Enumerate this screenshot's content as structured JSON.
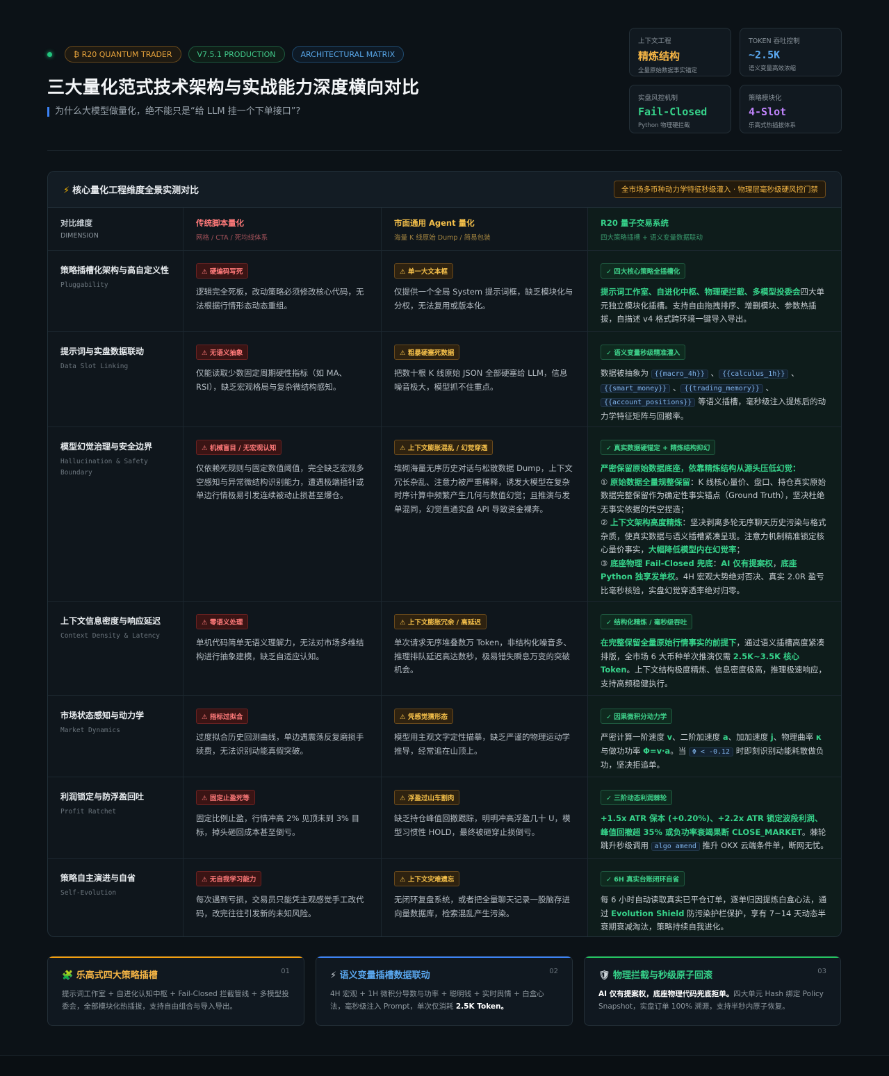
{
  "header": {
    "badges": [
      "₿ R20 QUANTUM TRADER",
      "V7.5.1 PRODUCTION",
      "ARCHITECTURAL MATRIX"
    ],
    "title": "三大量化范式技术架构与实战能力深度横向对比",
    "subtitle": "为什么大模型做量化，绝不能只是“给 LLM 挂一个下单接口”?"
  },
  "stats": [
    {
      "label": "上下文工程",
      "value": "精炼结构",
      "sub": "全量原始数据事实锚定",
      "color": "#f5b545"
    },
    {
      "label": "TOKEN 吞吐控制",
      "value": "~2.5K",
      "sub": "语义变量高效浓缩",
      "color": "#5aa8f0"
    },
    {
      "label": "实盘风控机制",
      "value": "Fail-Closed",
      "sub": "Python 物理硬拦截",
      "color": "#36d28a"
    },
    {
      "label": "策略模块化",
      "value": "4-Slot",
      "sub": "乐高式热插拔体系",
      "color": "#c084fc"
    }
  ],
  "panel": {
    "title": "核心量化工程维度全景实测对比",
    "tag": "全市场多币种动力学特征秒级灌入 · 物理层毫秒级硬风控门禁"
  },
  "columns": [
    {
      "a": "对比维度",
      "b": "DIMENSION",
      "ca": "#c5ccd2",
      "cb": "#8a949c"
    },
    {
      "a": "传统脚本量化",
      "b": "网格 / CTA / 死均线体系",
      "ca": "#ff7a7a",
      "cb": "#a4525a"
    },
    {
      "a": "市面通用 Agent 量化",
      "b": "海量 K 线原始 Dump / 简易包装",
      "ca": "#f5c04a",
      "cb": "#a38440"
    },
    {
      "a": "R20 量子交易系统",
      "b": "四大策略插槽 + 语义变量数据联动",
      "ca": "#36d28a",
      "cb": "#3a9a6e"
    }
  ],
  "rows": [
    {
      "dim": "策略插槽化架构与高自定义性",
      "dim_en": "Pluggability",
      "t1": "硬编码写死",
      "d1": "逻辑完全死板，改动策略必须修改核心代码，无法根据行情形态动态重组。",
      "t2": "单一大文本框",
      "d2": "仅提供一个全局 System 提示词框，缺乏模块化与分权，无法复用或版本化。",
      "t3": "四大核心策略全插槽化",
      "d3": [
        {
          "t": "提示词工作室、自进化中枢、物理硬拦截、多模型投委会",
          "c": "g"
        },
        {
          "t": "四大单元独立模块化插槽。支持自由拖拽排序、增删模块、参数热插拔，自描述 v4 格式跨环境一键导入导出。",
          "c": ""
        }
      ]
    },
    {
      "dim": "提示词与实盘数据联动",
      "dim_en": "Data Slot Linking",
      "t1": "无语义抽象",
      "d1": "仅能读取少数固定周期硬性指标（如 MA、RSI），缺乏宏观格局与复杂微结构感知。",
      "t2": "粗暴硬塞死数据",
      "d2": "把数十根 K 线原始 JSON 全部硬塞给 LLM，信息噪音极大，模型抓不住重点。",
      "t3": "语义变量秒级精准灌入",
      "d3": [
        {
          "t": "数据被抽象为 ",
          "c": ""
        },
        {
          "t": "{{macro_4h}}",
          "c": "code"
        },
        {
          "t": " 、",
          "c": ""
        },
        {
          "t": "{{calculus_1h}}",
          "c": "code"
        },
        {
          "t": " 、",
          "c": ""
        },
        {
          "t": "{{smart_money}}",
          "c": "code"
        },
        {
          "t": " 、",
          "c": ""
        },
        {
          "t": "{{trading_memory}}",
          "c": "code"
        },
        {
          "t": " 、",
          "c": ""
        },
        {
          "t": "{{account_positions}}",
          "c": "code"
        },
        {
          "t": " 等语义插槽，毫秒级注入提炼后的动力学特征矩阵与回撤率。",
          "c": ""
        }
      ]
    },
    {
      "dim": "模型幻觉治理与安全边界",
      "dim_en": "Hallucination & Safety Boundary",
      "t1": "机械盲目 / 无宏观认知",
      "d1": "仅依赖死规则与固定数值阈值，完全缺乏宏观多空感知与异常微结构识别能力，遭遇极端插针或单边行情极易引发连续被动止损甚至爆仓。",
      "t2": "上下文膨胀混乱 / 幻觉穿透",
      "d2": "堆砌海量无序历史对话与松散数据 Dump，上下文冗长杂乱、注意力被严重稀释，诱发大模型在复杂时序计算中频繁产生几何与数值幻觉；且推演与发单混同，幻觉直通实盘 API 导致资金裸奔。",
      "t3": "真实数据硬锚定 + 精炼结构抑幻",
      "d3": [
        {
          "t": "严密保留原始数据底座，依靠精炼结构从源头压低幻觉：",
          "c": "g"
        },
        {
          "t": "\n① ",
          "c": ""
        },
        {
          "t": "原始数据全量规整保留",
          "c": "g"
        },
        {
          "t": "：K 线核心量价、盘口、持仓真实原始数据完整保留作为确定性事实锚点（Ground Truth），坚决杜绝无事实依据的凭空捏造；",
          "c": ""
        },
        {
          "t": "\n② ",
          "c": ""
        },
        {
          "t": "上下文架构高度精炼",
          "c": "g"
        },
        {
          "t": "：坚决剥离多轮无序聊天历史污染与格式杂质，使真实数据与语义插槽紧凑呈现。注意力机制精准锁定核心量价事实，",
          "c": ""
        },
        {
          "t": "大幅降低模型内在幻觉率",
          "c": "g"
        },
        {
          "t": "；",
          "c": ""
        },
        {
          "t": "\n③ ",
          "c": ""
        },
        {
          "t": "底座物理 Fail-Closed 兜底",
          "c": "g"
        },
        {
          "t": "：",
          "c": ""
        },
        {
          "t": "AI 仅有提案权",
          "c": "g"
        },
        {
          "t": "，",
          "c": ""
        },
        {
          "t": "底座 Python 独享发单权",
          "c": "g"
        },
        {
          "t": "。4H 宏观大势绝对否决、真实 2.0R 盈亏比毫秒核验，实盘幻觉穿透率绝对归零。",
          "c": ""
        }
      ]
    },
    {
      "dim": "上下文信息密度与响应延迟",
      "dim_en": "Context Density & Latency",
      "t1": "零语义处理",
      "d1": "单机代码简单无语义理解力，无法对市场多维结构进行抽象建模，缺乏自适应认知。",
      "t2": "上下文膨胀冗余 / 高延迟",
      "d2": "单次请求无序堆叠数万 Token，非结构化噪音多、推理排队延迟高达数秒，极易错失瞬息万变的突破机会。",
      "t3": "结构化精炼 / 毫秒级吞吐",
      "d3": [
        {
          "t": "在完整保留全量原始行情事实的前提下",
          "c": "g"
        },
        {
          "t": "，通过语义插槽高度紧凑排版，全市场 6 大币种单次推演仅需 ",
          "c": ""
        },
        {
          "t": "2.5K~3.5K 核心 Token",
          "c": "g"
        },
        {
          "t": "。上下文结构极度精炼、信息密度极高，推理极速响应，支持高频稳健执行。",
          "c": ""
        }
      ]
    },
    {
      "dim": "市场状态感知与动力学",
      "dim_en": "Market Dynamics",
      "t1": "指标过拟合",
      "d1": "过度拟合历史回测曲线，单边遇震荡反复磨损手续费，无法识别动能真假突破。",
      "t2": "凭感觉猜形态",
      "d2": "模型用主观文字定性描摹，缺乏严谨的物理运动学推导，经常追在山顶上。",
      "t3": "因果微积分动力学",
      "d3": [
        {
          "t": "严密计算一阶速度 ",
          "c": ""
        },
        {
          "t": "v",
          "c": "g"
        },
        {
          "t": "、二阶加速度 ",
          "c": ""
        },
        {
          "t": "a",
          "c": "g"
        },
        {
          "t": "、加加速度 ",
          "c": ""
        },
        {
          "t": "j",
          "c": "g"
        },
        {
          "t": "、物理曲率 ",
          "c": ""
        },
        {
          "t": "κ",
          "c": "g"
        },
        {
          "t": " 与做功功率 ",
          "c": ""
        },
        {
          "t": "Φ=v·a",
          "c": "g"
        },
        {
          "t": "。当 ",
          "c": ""
        },
        {
          "t": "Φ < -0.12",
          "c": "code"
        },
        {
          "t": " 时即刻识别动能耗散做负功，坚决拒追单。",
          "c": ""
        }
      ]
    },
    {
      "dim": "利润锁定与防浮盈回吐",
      "dim_en": "Profit Ratchet",
      "t1": "固定止盈死等",
      "d1": "固定比例止盈，行情冲高 2% 见顶未到 3% 目标，掉头砸回成本甚至倒亏。",
      "t2": "浮盈过山车割肉",
      "d2": "缺乏持仓峰值回撤跟踪，明明冲高浮盈几十 U，模型习惯性 HOLD，最终被砸穿止损倒亏。",
      "t3": "三阶动态利润棘轮",
      "d3": [
        {
          "t": "+1.5x ATR 保本 (+0.20%)、+2.2x ATR 锁定波段利润、峰值回撤超 35% 或负功率衰竭果断 CLOSE_MARKET",
          "c": "g"
        },
        {
          "t": "。棘轮跳升秒级调用 ",
          "c": ""
        },
        {
          "t": "algo amend",
          "c": "code"
        },
        {
          "t": " 推升 OKX 云端条件单，断网无忧。",
          "c": ""
        }
      ]
    },
    {
      "dim": "策略自主演进与自省",
      "dim_en": "Self-Evolution",
      "t1": "无自我学习能力",
      "d1": "每次遇到亏损，交易员只能凭主观感觉手工改代码，改完往往引发新的未知风险。",
      "t2": "上下文灾难遗忘",
      "d2": "无闭环复盘系统，或者把全量聊天记录一股脑存进向量数据库，检索混乱产生污染。",
      "t3": "6H 真实台账闭环自省",
      "d3": [
        {
          "t": "每 6 小时自动读取真实已平仓订单，逐单归因提炼白盒心法，通过 ",
          "c": ""
        },
        {
          "t": "Evolution Shield",
          "c": "g"
        },
        {
          "t": " 防污染护栏保护，享有 7~14 天动态半衰期衰减淘汰，策略持续自我进化。",
          "c": ""
        }
      ]
    }
  ],
  "cards": [
    {
      "icon": "🧩",
      "title": "乐高式四大策略插槽",
      "num": "01",
      "color": "#f5b545",
      "bar": "#f59e0b",
      "desc": "提示词工作室 + 自进化认知中枢 + Fail-Closed 拦截管线 + 多模型投委会，全部模块化热插拔，支持自由组合与导入导出。",
      "strong": ""
    },
    {
      "icon": "⚡",
      "title": "语义变量插槽数据联动",
      "num": "02",
      "color": "#5aa8f0",
      "bar": "#3b82f6",
      "desc": "4H 宏观 + 1H 微积分导数与功率 + 聪明钱 + 实时舆情 + 白盒心法，毫秒级注入 Prompt，单次仅消耗 ",
      "strong": "2.5K Token。"
    },
    {
      "icon": "🛡",
      "title": "物理拦截与秒级原子回滚",
      "num": "03",
      "color": "#36d28a",
      "bar": "#22c55e",
      "desc": "四大单元 Hash 绑定 Policy Snapshot，实盘订单 100% 溯源，支持半秒内原子恢复。",
      "strong_first": "AI 仅有提案权，底座物理代码兜底拒单。"
    }
  ]
}
